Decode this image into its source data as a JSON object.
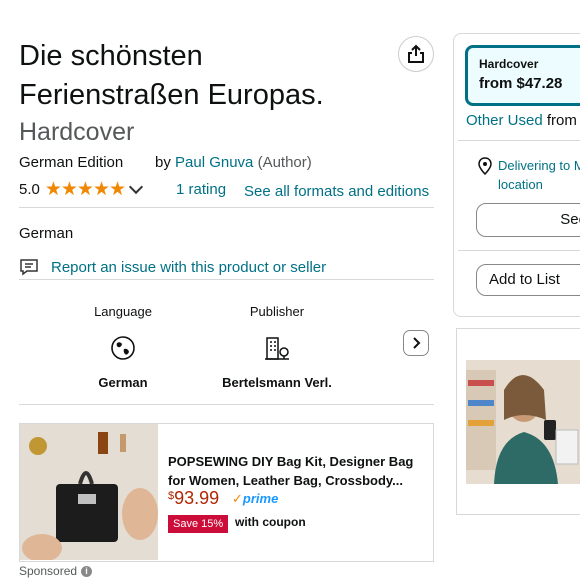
{
  "product": {
    "title_line1": "Die schönsten",
    "title_line2": "Ferienstraßen Europas.",
    "format": "Hardcover",
    "edition": "German Edition",
    "by": "by",
    "author": "Paul Gnuva",
    "author_role": "(Author)",
    "rating_value": "5.0",
    "stars": "★★★★★",
    "ratings_count": "1 rating",
    "formats_link": "See all formats and editions",
    "language_text": "German",
    "report_link": "Report an issue with this product or seller"
  },
  "attributes": [
    {
      "label": "Language",
      "value": "German",
      "icon": "globe-icon"
    },
    {
      "label": "Publisher",
      "value": "Bertelsmann Verl.",
      "icon": "building-icon"
    }
  ],
  "ad": {
    "title": "POPSEWING DIY Bag Kit, Designer Bag for Women, Leather Bag, Crossbody...",
    "price_currency": "$",
    "price_value": "93.99",
    "prime_label": "prime",
    "save_badge": "Save 15%",
    "coupon_text": "with coupon",
    "sponsored": "Sponsored",
    "info": "i"
  },
  "buy_box": {
    "format_label": "Hardcover",
    "format_price": "from $47.28",
    "other_used": "Other Used",
    "other_used_suffix": "from",
    "delivering": "Delivering to M",
    "location": "location",
    "see_button": "See",
    "add_to_list": "Add to List"
  },
  "colors": {
    "link": "#007185",
    "star": "#f08804",
    "price": "#b12704",
    "badge": "#cc0c39",
    "prime": "#1a98ff"
  }
}
